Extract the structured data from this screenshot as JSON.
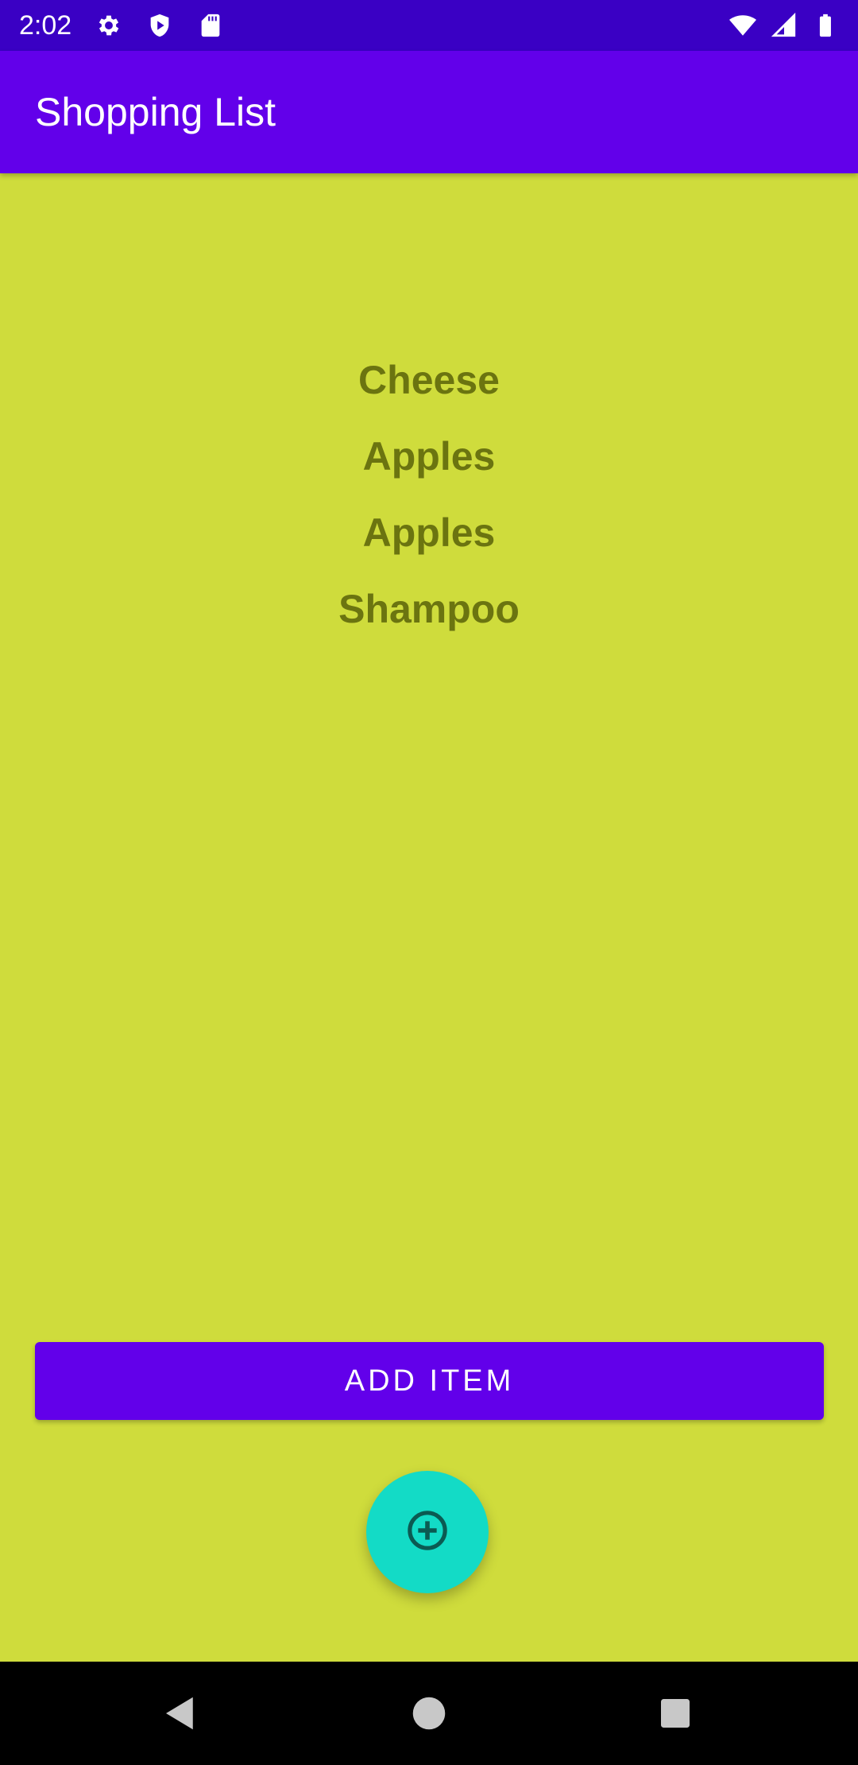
{
  "status_bar": {
    "time": "2:02",
    "left_icons": [
      "gear-icon",
      "shield-play-icon",
      "sd-card-icon"
    ],
    "right_icons": [
      "wifi-icon",
      "cellular-signal-icon",
      "battery-icon"
    ]
  },
  "app_bar": {
    "title": "Shopping List",
    "color": "#6200ea"
  },
  "list": {
    "items": [
      "Cheese",
      "Apples",
      "Apples",
      "Shampoo"
    ]
  },
  "add_button": {
    "label": "ADD ITEM"
  },
  "fab": {
    "icon": "add-circle-icon",
    "color": "#13dbc6"
  },
  "navigation": {
    "buttons": [
      "back-icon",
      "home-icon",
      "recents-icon"
    ]
  },
  "colors": {
    "background": "#cfdc3c",
    "status_bar": "#3a00c4",
    "list_text": "#6b7410"
  }
}
